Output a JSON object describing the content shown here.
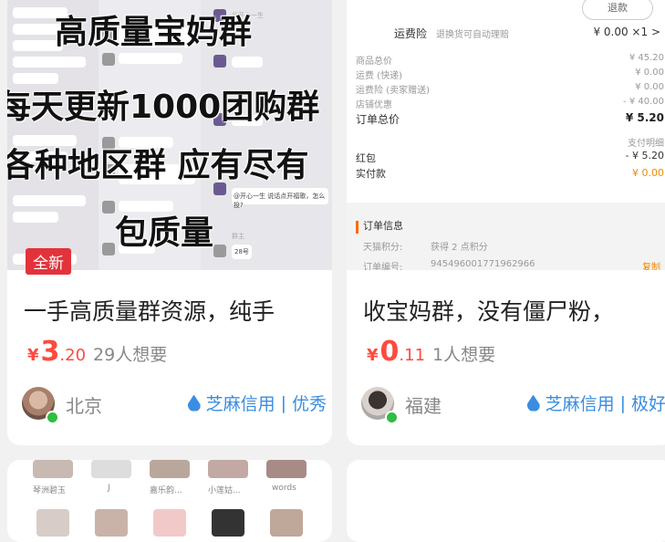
{
  "left_card": {
    "badge": "全新",
    "overlay_lines": [
      "高质量宝妈群",
      "每天更新1000团购群",
      "各种地区群 应有尽有",
      "包质量"
    ],
    "title": "一手高质量群资源，纯手",
    "price_symbol": "¥",
    "price_int": "3",
    "price_dec": ".20",
    "wants": "29人想要",
    "city": "北京",
    "credit_brand": "芝麻信用",
    "credit_level": "优秀",
    "chat_snippets": [
      "@开心一生",
      "@开心一生 说话点开福歌，怎么投?",
      "28号",
      "群主"
    ],
    "bottom_thumbs": [
      "琴洲碧玉",
      "J",
      "嘉乐韵...",
      "小莲姑...",
      "words"
    ]
  },
  "right_card": {
    "title": "收宝妈群，没有僵尸粉，",
    "price_symbol": "¥",
    "price_int": "0",
    "price_dec": ".11",
    "wants": "1人想要",
    "city": "福建",
    "credit_brand": "芝麻信用",
    "credit_level": "极好",
    "order": {
      "refund_button": "退款",
      "shipping_insurance_label": "运费险",
      "shipping_insurance_desc": "退换货可自动理赔",
      "shipping_insurance_value": "¥ 0.00 ×1 >",
      "rows": [
        {
          "label": "商品总价",
          "value": "¥ 45.20"
        },
        {
          "label": "运费 (快递)",
          "value": "¥ 0.00"
        },
        {
          "label": "运费险 (卖家赠送)",
          "value": "¥ 0.00"
        },
        {
          "label": "店铺优惠",
          "value": "- ¥ 40.00"
        }
      ],
      "total_label": "订单总价",
      "total_value": "¥ 5.20",
      "payment_detail": "支付明细",
      "redpacket_label": "红包",
      "redpacket_value": "- ¥ 5.20",
      "paid_label": "实付款",
      "paid_value": "¥ 0.00",
      "info_title": "订单信息",
      "points_label": "天猫积分:",
      "points_value": "获得 2 点积分",
      "order_no_label": "订单编号:",
      "order_no_value": "945496001771962966",
      "copy": "复制"
    }
  },
  "colors": {
    "price": "#ff4a3d",
    "credit": "#3a8de0",
    "badge": "#e2333b",
    "online": "#2fbd42"
  }
}
